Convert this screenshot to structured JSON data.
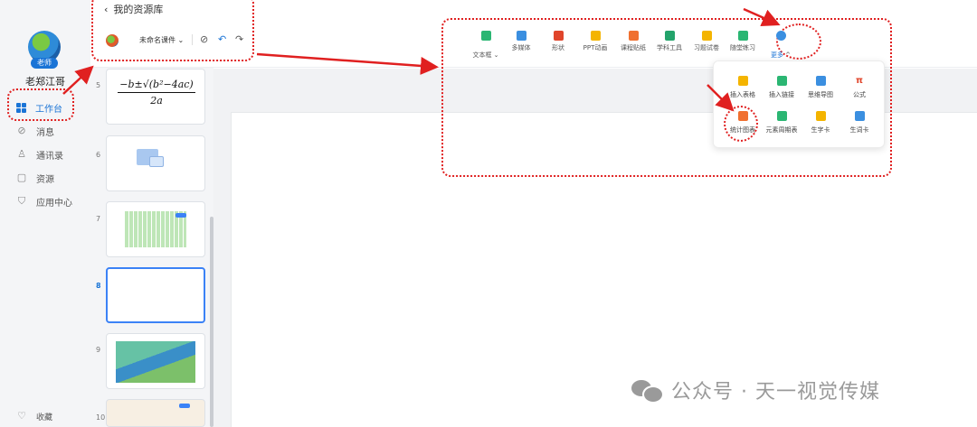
{
  "user": {
    "name": "老郑江哥",
    "badge": "老师"
  },
  "nav": {
    "items": [
      {
        "label": "工作台",
        "icon": "grid-icon",
        "active": true
      },
      {
        "label": "消息",
        "icon": "check-circle-icon"
      },
      {
        "label": "通讯录",
        "icon": "contacts-icon"
      },
      {
        "label": "资源",
        "icon": "folder-icon"
      },
      {
        "label": "应用中心",
        "icon": "shield-icon"
      }
    ],
    "bottom": {
      "label": "收藏",
      "icon": "heart-icon"
    }
  },
  "header": {
    "back_label": "我的资源库",
    "file_name": "未命名课件"
  },
  "ribbon": [
    {
      "label": "文本框",
      "color": "#2bb673"
    },
    {
      "label": "多媒体",
      "color": "#3b8fe0"
    },
    {
      "label": "形状",
      "color": "#e0452b"
    },
    {
      "label": "PPT动画",
      "color": "#f4b400"
    },
    {
      "label": "课程贴纸",
      "color": "#f07030"
    },
    {
      "label": "学科工具",
      "color": "#23a36b"
    },
    {
      "label": "习题试卷",
      "color": "#f4b400"
    },
    {
      "label": "随堂练习",
      "color": "#2bb673"
    },
    {
      "label": "更多",
      "color": "#3b8fe0"
    }
  ],
  "dropdown": [
    {
      "label": "插入表格",
      "icon": "table-icon",
      "color": "#f4b400"
    },
    {
      "label": "插入链接",
      "icon": "link-icon",
      "color": "#2bb673"
    },
    {
      "label": "思维导图",
      "icon": "mindmap-icon",
      "color": "#3b8fe0"
    },
    {
      "label": "公式",
      "icon": "pi-icon",
      "color": "#e0452b"
    },
    {
      "label": "统计图表",
      "icon": "bar-chart-icon",
      "color": "#f07030"
    },
    {
      "label": "元素周期表",
      "icon": "atom-icon",
      "color": "#2bb673"
    },
    {
      "label": "生字卡",
      "icon": "card-icon",
      "color": "#f4b400"
    },
    {
      "label": "生词卡",
      "icon": "search-card-icon",
      "color": "#3b8fe0"
    }
  ],
  "slides": [
    {
      "num": "5",
      "content": "formula"
    },
    {
      "num": "6",
      "content": "image"
    },
    {
      "num": "7",
      "content": "periodic-table"
    },
    {
      "num": "8",
      "content": "blank",
      "active": true
    },
    {
      "num": "9",
      "content": "game"
    },
    {
      "num": "10",
      "content": "chart"
    }
  ],
  "formula": {
    "numerator": "−b±√(b²−4ac)",
    "denominator": "2a"
  },
  "pi_glyph": "π",
  "watermark": "公众号 · 天一视觉传媒"
}
